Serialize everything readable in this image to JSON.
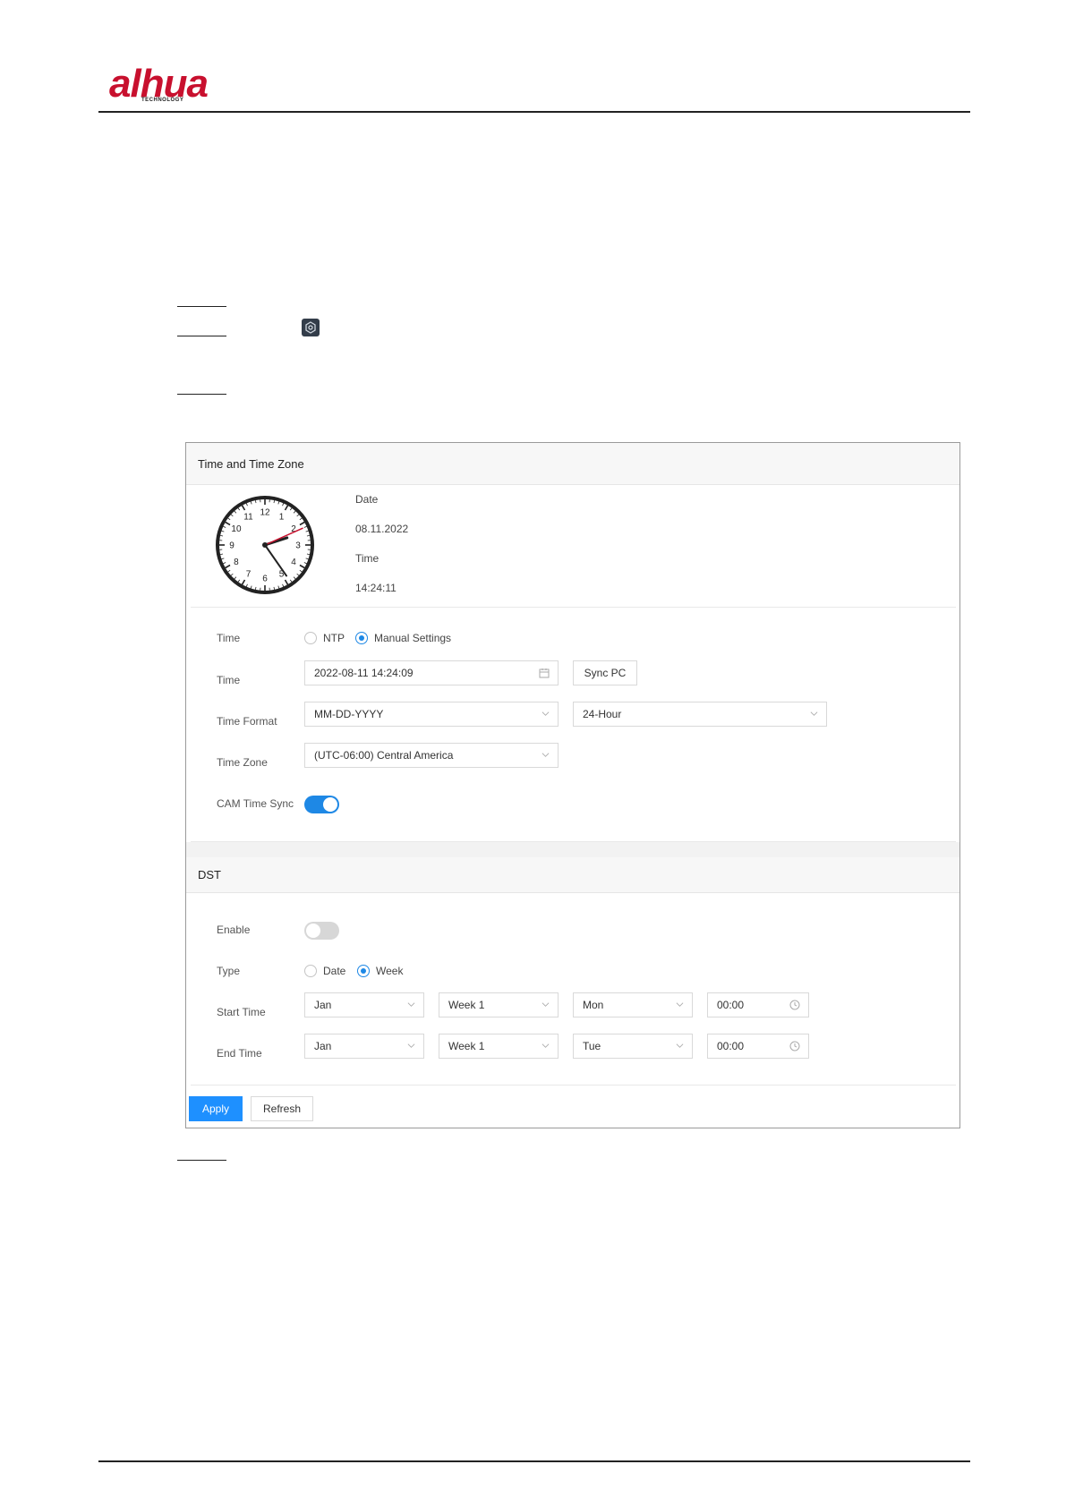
{
  "brand": {
    "logo_text": "alhua",
    "logo_subtext": "TECHNOLOGY",
    "logo_color": "#c8102e"
  },
  "panel": {
    "title": "Time and Time Zone",
    "clock": {
      "hour": 14,
      "minute": 24,
      "second": 11,
      "numerals": [
        "12",
        "1",
        "2",
        "3",
        "4",
        "5",
        "6",
        "7",
        "8",
        "9",
        "10",
        "11"
      ]
    },
    "date_label": "Date",
    "date_value": "08.11.2022",
    "time_label": "Time",
    "time_value": "14:24:11",
    "time_mode": {
      "label": "Time",
      "options": [
        "NTP",
        "Manual Settings"
      ],
      "selected": "Manual Settings"
    },
    "time_field": {
      "label": "Time",
      "value": "2022-08-11 14:24:09",
      "sync_button": "Sync PC"
    },
    "time_format": {
      "label": "Time Format",
      "date_format": "MM-DD-YYYY",
      "hour_format": "24-Hour"
    },
    "time_zone": {
      "label": "Time Zone",
      "value": "(UTC-06:00) Central America"
    },
    "cam_time_sync": {
      "label": "CAM Time Sync",
      "enabled": true
    },
    "dst": {
      "title": "DST",
      "enable": {
        "label": "Enable",
        "enabled": false
      },
      "type": {
        "label": "Type",
        "options": [
          "Date",
          "Week"
        ],
        "selected": "Week"
      },
      "start": {
        "label": "Start Time",
        "month": "Jan",
        "week": "Week 1",
        "day": "Mon",
        "time": "00:00"
      },
      "end": {
        "label": "End Time",
        "month": "Jan",
        "week": "Week 1",
        "day": "Tue",
        "time": "00:00"
      }
    },
    "buttons": {
      "apply": "Apply",
      "refresh": "Refresh"
    },
    "accent_color": "#1e88e5"
  }
}
